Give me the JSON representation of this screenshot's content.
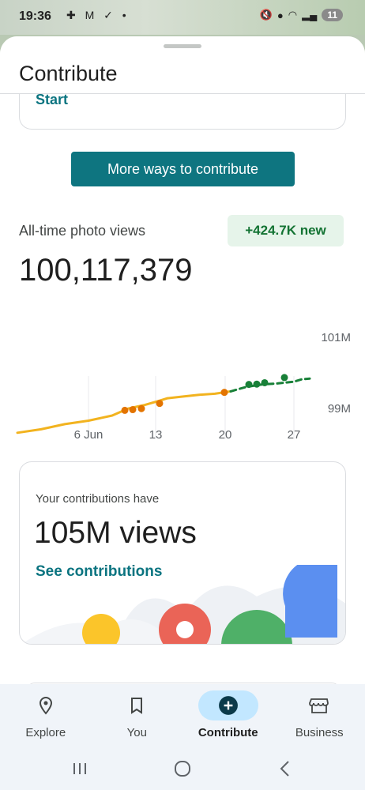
{
  "status_bar": {
    "time": "19:36",
    "left_icons": "✚ M ✓ •",
    "battery": "11"
  },
  "sheet": {
    "title": "Contribute"
  },
  "top_card": {
    "link": "Start"
  },
  "more_ways_button": "More ways to contribute",
  "photo_views": {
    "label": "All-time photo views",
    "new_badge": "+424.7K new",
    "total": "100,117,379"
  },
  "chart_data": {
    "type": "line",
    "x_labels": [
      "6 Jun",
      "13",
      "20",
      "27"
    ],
    "y_labels": [
      "101M",
      "99M"
    ],
    "ylim": [
      98.3,
      101
    ],
    "series": [
      {
        "color": "#f2b31f",
        "points": [
          [
            0,
            98.35
          ],
          [
            3,
            98.45
          ],
          [
            6,
            98.6
          ],
          [
            9,
            98.7
          ],
          [
            12,
            98.85
          ],
          [
            13,
            98.95
          ],
          [
            14,
            99.05
          ],
          [
            16,
            99.15
          ],
          [
            18,
            99.28
          ],
          [
            19,
            99.35
          ],
          [
            21,
            99.4
          ],
          [
            23,
            99.45
          ],
          [
            25,
            99.48
          ],
          [
            27,
            99.55
          ]
        ]
      },
      {
        "color": "#188038",
        "dashed": true,
        "points": [
          [
            27,
            99.55
          ],
          [
            29,
            99.68
          ],
          [
            31,
            99.75
          ],
          [
            33,
            99.78
          ],
          [
            35,
            99.83
          ],
          [
            36,
            99.9
          ],
          [
            37,
            99.92
          ]
        ]
      }
    ],
    "markers": [
      {
        "x": 13.6,
        "y": 99.0,
        "color": "#e37400"
      },
      {
        "x": 14.6,
        "y": 99.02,
        "color": "#e37400"
      },
      {
        "x": 15.7,
        "y": 99.05,
        "color": "#e37400"
      },
      {
        "x": 18,
        "y": 99.2,
        "color": "#e37400"
      },
      {
        "x": 26.2,
        "y": 99.52,
        "color": "#e37400"
      },
      {
        "x": 29.3,
        "y": 99.75,
        "color": "#188038"
      },
      {
        "x": 30.3,
        "y": 99.76,
        "color": "#188038"
      },
      {
        "x": 31.3,
        "y": 99.8,
        "color": "#188038"
      },
      {
        "x": 33.8,
        "y": 99.95,
        "color": "#188038"
      }
    ],
    "x_tick_positions": [
      9,
      17.5,
      26.3,
      35
    ]
  },
  "contributions_card": {
    "subtitle": "Your contributions have",
    "views": "105M views",
    "link": "See contributions"
  },
  "bottom_nav": [
    {
      "label": "Explore",
      "icon": "pin-icon",
      "active": false
    },
    {
      "label": "You",
      "icon": "bookmark-icon",
      "active": false
    },
    {
      "label": "Contribute",
      "icon": "add-circle-icon",
      "active": true
    },
    {
      "label": "Business",
      "icon": "store-icon",
      "active": false
    }
  ],
  "colors": {
    "accent": "#0e7580",
    "positive": "#137333",
    "nav_active": "#c2e7ff"
  }
}
